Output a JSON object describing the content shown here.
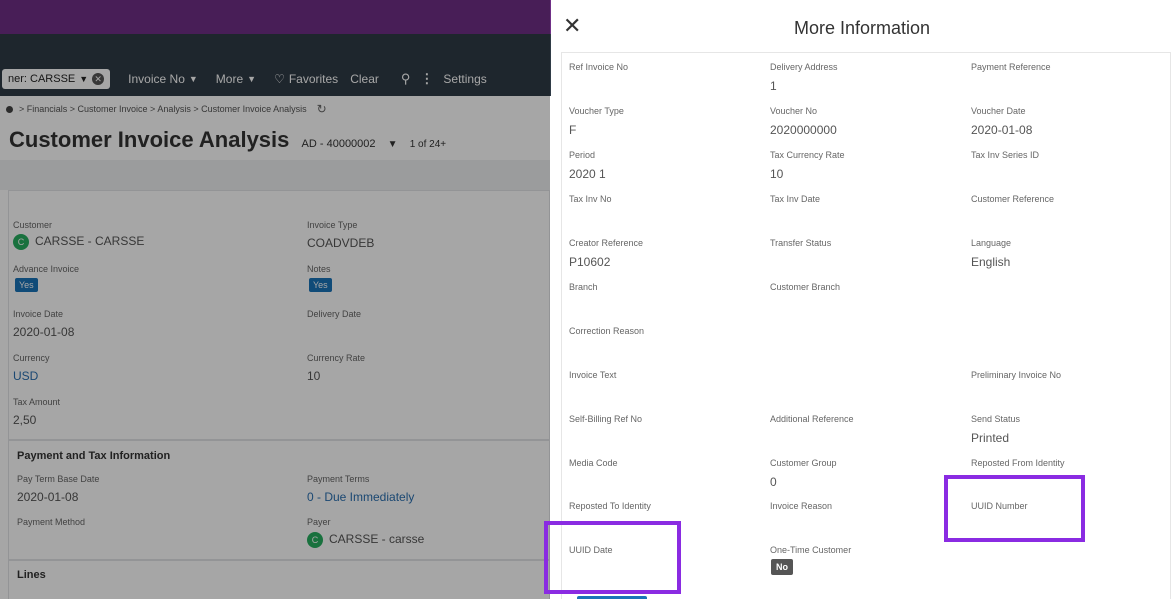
{
  "toolbar": {
    "filter_chip": "ner: CARSSE",
    "invoice_no": "Invoice No",
    "more": "More",
    "favorites": "Favorites",
    "clear": "Clear",
    "settings": "Settings"
  },
  "breadcrumb": "> Financials > Customer Invoice > Analysis > Customer Invoice Analysis",
  "page": {
    "title": "Customer Invoice Analysis",
    "code": "AD - 40000002",
    "count": "1 of 24+"
  },
  "main": {
    "customer_label": "Customer",
    "customer_avatar": "C",
    "customer_value": "CARSSE - CARSSE",
    "invoice_type_label": "Invoice Type",
    "invoice_type_value": "COADVDEB",
    "advance_invoice_label": "Advance Invoice",
    "advance_invoice_value": "Yes",
    "notes_label": "Notes",
    "notes_value": "Yes",
    "invoice_date_label": "Invoice Date",
    "invoice_date_value": "2020-01-08",
    "delivery_date_label": "Delivery Date",
    "currency_label": "Currency",
    "currency_value": "USD",
    "currency_rate_label": "Currency Rate",
    "currency_rate_value": "10",
    "tax_amount_label": "Tax Amount",
    "tax_amount_value": "2,50"
  },
  "payment": {
    "section_title": "Payment and Tax Information",
    "pay_term_base_date_label": "Pay Term Base Date",
    "pay_term_base_date_value": "2020-01-08",
    "payment_terms_label": "Payment Terms",
    "payment_terms_value": "0 - Due Immediately",
    "payment_method_label": "Payment Method",
    "payer_label": "Payer",
    "payer_avatar": "C",
    "payer_value": "CARSSE - carsse"
  },
  "lines": {
    "section_title": "Lines"
  },
  "dialog": {
    "title": "More Information",
    "fields": {
      "ref_invoice_no": {
        "label": "Ref Invoice No",
        "value": ""
      },
      "delivery_address": {
        "label": "Delivery Address",
        "value": "1"
      },
      "payment_reference": {
        "label": "Payment Reference",
        "value": ""
      },
      "voucher_type": {
        "label": "Voucher Type",
        "value": "F"
      },
      "voucher_no": {
        "label": "Voucher No",
        "value": "2020000000"
      },
      "voucher_date": {
        "label": "Voucher Date",
        "value": "2020-01-08"
      },
      "period": {
        "label": "Period",
        "value": "2020 1"
      },
      "tax_currency_rate": {
        "label": "Tax Currency Rate",
        "value": "10"
      },
      "tax_inv_series_id": {
        "label": "Tax Inv Series ID",
        "value": ""
      },
      "tax_inv_no": {
        "label": "Tax Inv No",
        "value": ""
      },
      "tax_inv_date": {
        "label": "Tax Inv Date",
        "value": ""
      },
      "customer_reference": {
        "label": "Customer Reference",
        "value": ""
      },
      "creator_reference": {
        "label": "Creator Reference",
        "value": "P10602"
      },
      "transfer_status": {
        "label": "Transfer Status",
        "value": ""
      },
      "language": {
        "label": "Language",
        "value": "English"
      },
      "branch": {
        "label": "Branch",
        "value": ""
      },
      "customer_branch": {
        "label": "Customer Branch",
        "value": ""
      },
      "correction_reason": {
        "label": "Correction Reason",
        "value": ""
      },
      "invoice_text": {
        "label": "Invoice Text",
        "value": ""
      },
      "preliminary_invoice_no": {
        "label": "Preliminary Invoice No",
        "value": ""
      },
      "self_billing_ref_no": {
        "label": "Self-Billing Ref No",
        "value": ""
      },
      "additional_reference": {
        "label": "Additional Reference",
        "value": ""
      },
      "send_status": {
        "label": "Send Status",
        "value": "Printed"
      },
      "media_code": {
        "label": "Media Code",
        "value": ""
      },
      "customer_group": {
        "label": "Customer Group",
        "value": "0"
      },
      "reposted_from_identity": {
        "label": "Reposted From Identity",
        "value": ""
      },
      "reposted_to_identity": {
        "label": "Reposted To Identity",
        "value": ""
      },
      "invoice_reason": {
        "label": "Invoice Reason",
        "value": ""
      },
      "uuid_number": {
        "label": "UUID Number",
        "value": ""
      },
      "uuid_date": {
        "label": "UUID Date",
        "value": ""
      },
      "one_time_customer": {
        "label": "One-Time Customer",
        "value": "No"
      }
    }
  },
  "colors": {
    "banner": "#6f2f86",
    "toolbar": "#2f3b46",
    "highlight": "#8a2be2",
    "link": "#2a6fb0",
    "badge_yes": "#1a73b8"
  }
}
